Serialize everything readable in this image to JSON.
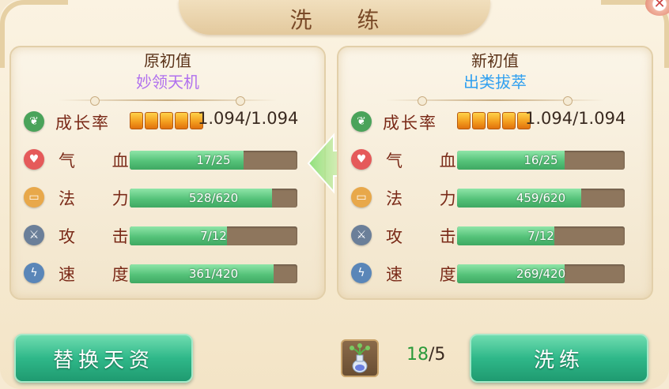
{
  "title": "洗 练",
  "close_icon": "close-icon",
  "left_panel": {
    "title": "原初值",
    "subtitle": "妙领天机",
    "growth": {
      "label": "成长率",
      "stars": 5,
      "value": "1.094/1.094"
    },
    "stats": [
      {
        "label": "气 血",
        "text": "17/25",
        "fraction": 0.68,
        "icon": "heart-icon"
      },
      {
        "label": "法 力",
        "text": "528/620",
        "fraction": 0.85,
        "icon": "scroll-icon"
      },
      {
        "label": "攻 击",
        "text": "7/12",
        "fraction": 0.58,
        "icon": "sword-icon"
      },
      {
        "label": "速 度",
        "text": "361/420",
        "fraction": 0.86,
        "icon": "lightning-icon"
      }
    ]
  },
  "right_panel": {
    "title": "新初值",
    "subtitle": "出类拔萃",
    "growth": {
      "label": "成长率",
      "stars": 5,
      "value": "1.094/1.094"
    },
    "stats": [
      {
        "label": "气 血",
        "text": "16/25",
        "fraction": 0.64,
        "icon": "heart-icon"
      },
      {
        "label": "法 力",
        "text": "459/620",
        "fraction": 0.74,
        "icon": "scroll-icon"
      },
      {
        "label": "攻 击",
        "text": "7/12",
        "fraction": 0.58,
        "icon": "sword-icon"
      },
      {
        "label": "速 度",
        "text": "269/420",
        "fraction": 0.64,
        "icon": "lightning-icon"
      }
    ]
  },
  "buttons": {
    "replace": "替换天资",
    "refine": "洗练"
  },
  "item": {
    "icon": "potion-vase-icon",
    "have": "18",
    "sep": "/",
    "need": "5"
  },
  "colors": {
    "button_green": "#2fb889",
    "bar_fill": "#55c279",
    "bar_track": "#8e765d",
    "subtitle_purple": "#b070ee",
    "subtitle_blue": "#2e9ff0"
  }
}
